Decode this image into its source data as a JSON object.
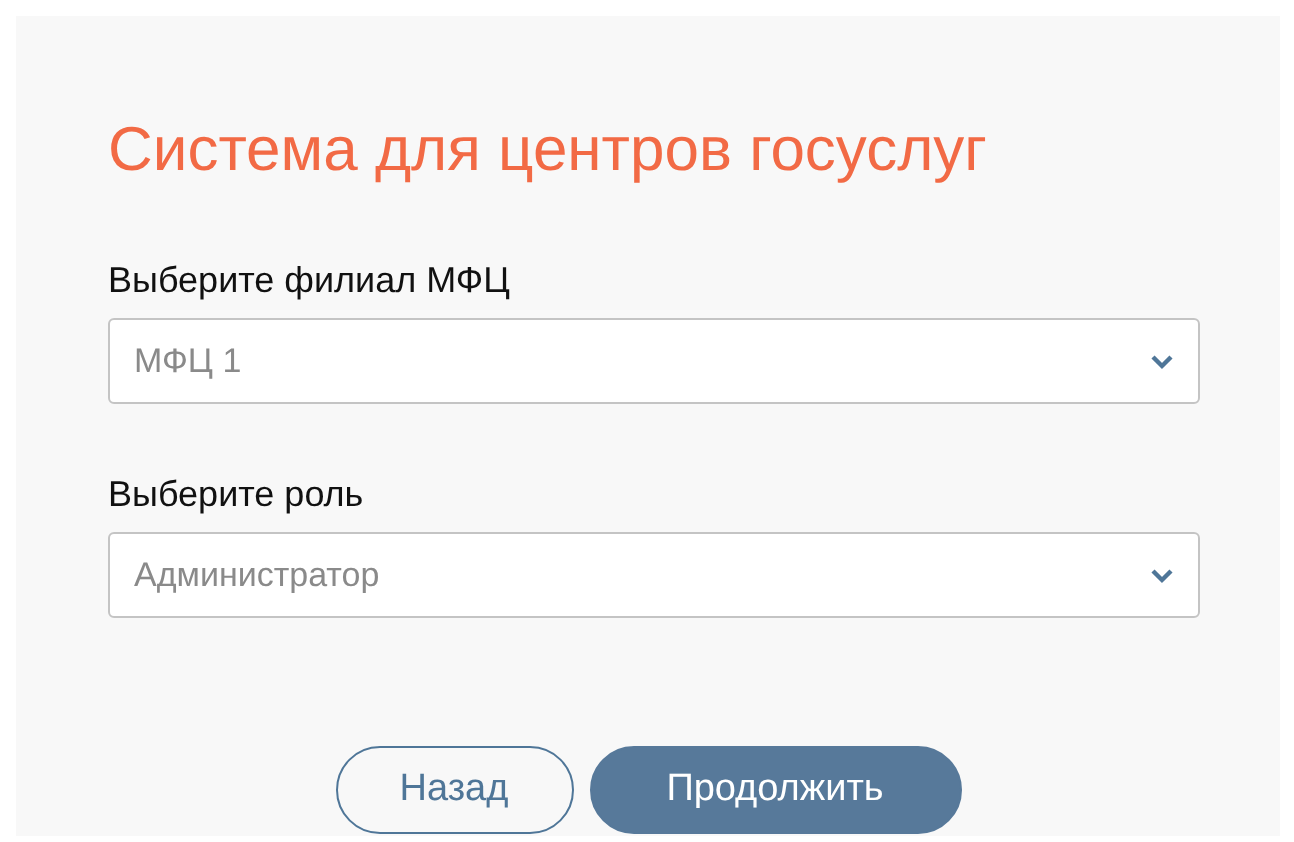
{
  "title": "Система для центров госуслуг",
  "fields": [
    {
      "label": "Выберите филиал МФЦ",
      "value": "МФЦ 1"
    },
    {
      "label": "Выберите роль",
      "value": "Администратор"
    }
  ],
  "buttons": [
    {
      "label": "Назад",
      "kind": "outline"
    },
    {
      "label": "Продолжить",
      "kind": "primary"
    }
  ]
}
